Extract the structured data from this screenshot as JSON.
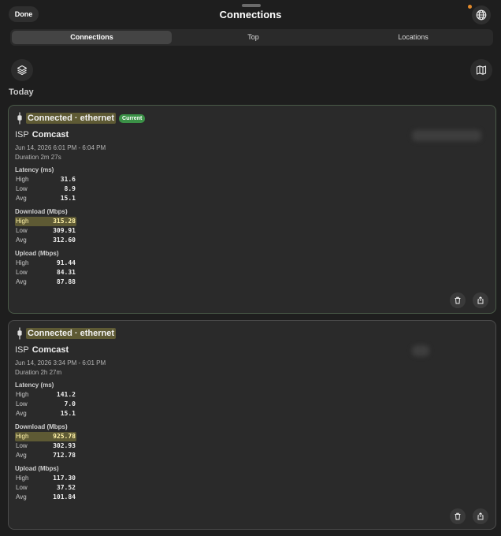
{
  "header": {
    "done_label": "Done",
    "title": "Connections"
  },
  "tabs": [
    {
      "label": "Connections",
      "active": true
    },
    {
      "label": "Top",
      "active": false
    },
    {
      "label": "Locations",
      "active": false
    }
  ],
  "section_label": "Today",
  "colors": {
    "highlight": "#5e5a34",
    "current_badge": "#3b9147",
    "background": "#1e1e1e",
    "card": "#2a2a2a"
  },
  "cards": [
    {
      "title": "Connected · ethernet",
      "badge": "Current",
      "isp_label": "ISP",
      "isp": "Comcast",
      "time_range": "Jun 14, 2026 6:01 PM - 6:04 PM",
      "duration": "Duration 2m 27s",
      "latency": {
        "title": "Latency (ms)",
        "high": "31.6",
        "low": "8.9",
        "avg": "15.1"
      },
      "download": {
        "title": "Download (Mbps)",
        "high": "315.28",
        "low": "309.91",
        "avg": "312.60"
      },
      "upload": {
        "title": "Upload (Mbps)",
        "high": "91.44",
        "low": "84.31",
        "avg": "87.88"
      }
    },
    {
      "title": "Connected · ethernet",
      "isp_label": "ISP",
      "isp": "Comcast",
      "time_range": "Jun 14, 2026 3:34 PM - 6:01 PM",
      "duration": "Duration 2h 27m",
      "latency": {
        "title": "Latency (ms)",
        "high": "141.2",
        "low": "7.0",
        "avg": "15.1"
      },
      "download": {
        "title": "Download (Mbps)",
        "high": "925.78",
        "low": "302.93",
        "avg": "712.78"
      },
      "upload": {
        "title": "Upload (Mbps)",
        "high": "117.30",
        "low": "37.52",
        "avg": "101.84"
      }
    }
  ],
  "row_labels": {
    "high": "High",
    "low": "Low",
    "avg": "Avg"
  }
}
